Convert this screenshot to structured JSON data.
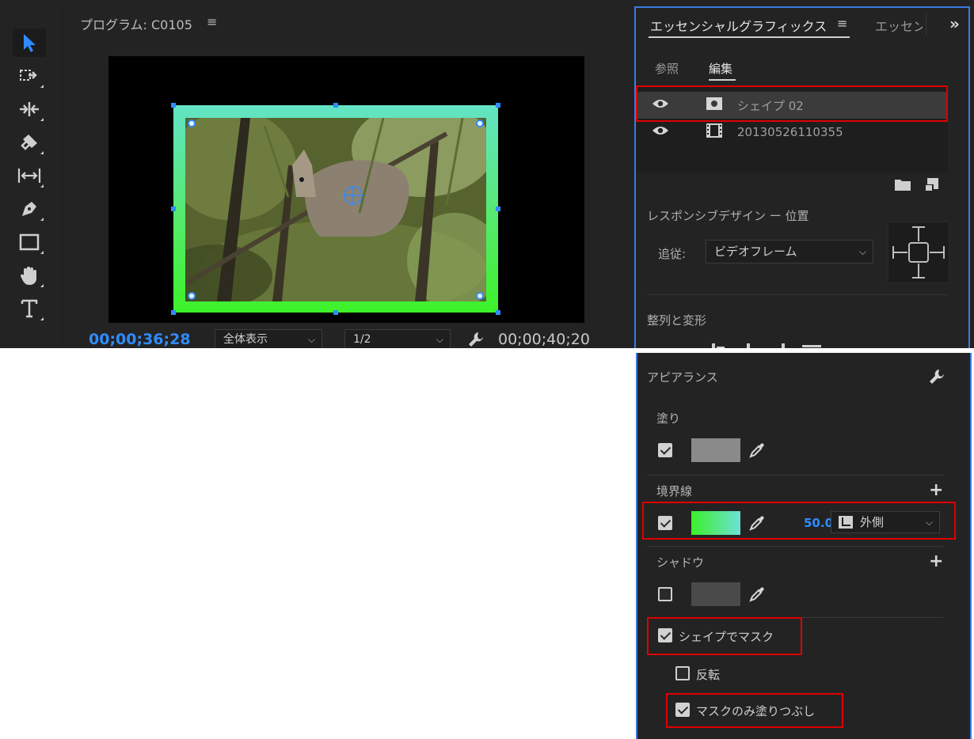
{
  "program_monitor": {
    "title": "プログラム: C0105",
    "menu_icon": "≡",
    "timecode_current": "00;00;36;28",
    "zoom_select": "全体表示",
    "resolution_select": "1/2",
    "timecode_duration": "00;00;40;20"
  },
  "essential_graphics": {
    "tab_active": "エッセンシャルグラフィックス",
    "tab_menu_icon": "≡",
    "tab_inactive": "エッセン",
    "more_icon": "»",
    "subtabs": {
      "browse": "参照",
      "edit": "編集"
    },
    "layers": [
      {
        "name": "シェイプ 02",
        "type": "shape",
        "selected": true
      },
      {
        "name": "20130526110355",
        "type": "clip",
        "selected": false
      }
    ],
    "responsive": {
      "title": "レスポンシブデザイン ー 位置",
      "follow_label": "追従:",
      "follow_value": "ビデオフレーム"
    },
    "align_title": "整列と変形"
  },
  "appearance": {
    "title": "アピアランス",
    "fill": {
      "label": "塗り",
      "checked": true,
      "color": "#8a8a8a"
    },
    "stroke": {
      "label": "境界線",
      "checked": true,
      "gradient_start": "#3cf02a",
      "gradient_end": "#6ee0d8",
      "width": "50.0",
      "position": "外側"
    },
    "shadow": {
      "label": "シャドウ",
      "checked": false,
      "color": "#4a4a4a"
    },
    "mask_with_shape": {
      "label": "シェイプでマスク",
      "checked": true
    },
    "invert": {
      "label": "反転",
      "checked": false
    },
    "mask_fill_only": {
      "label": "マスクのみ塗りつぶし",
      "checked": true
    }
  },
  "colors": {
    "accent_blue": "#2f8cff",
    "highlight_red": "#e00000",
    "panel_bg": "#232323",
    "stroke_green": "#3df22a"
  }
}
